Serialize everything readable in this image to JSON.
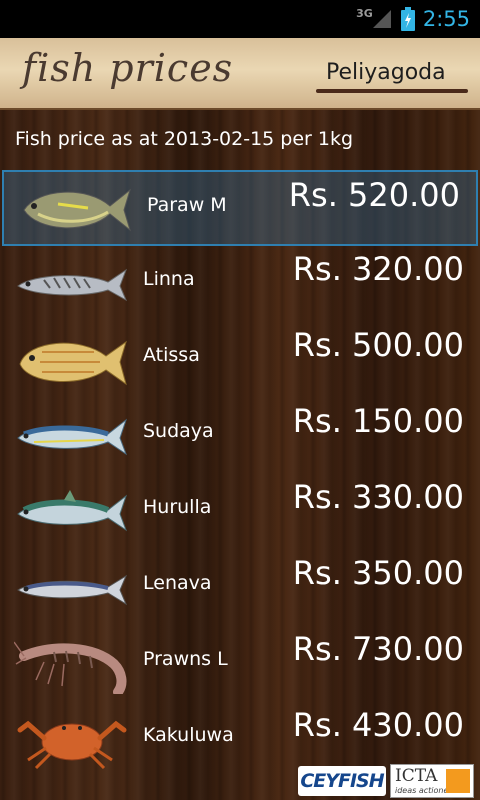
{
  "status_bar": {
    "network": "3G",
    "time": "2:55"
  },
  "header": {
    "title": "fish prices",
    "location": "Peliyagoda"
  },
  "subtitle": "Fish price as at 2013-02-15 per 1kg",
  "fish": [
    {
      "name": "Paraw M",
      "price": "Rs. 520.00",
      "icon": "paraw-fish-icon",
      "selected": true
    },
    {
      "name": "Linna",
      "price": "Rs. 320.00",
      "icon": "linna-fish-icon"
    },
    {
      "name": "Atissa",
      "price": "Rs. 500.00",
      "icon": "atissa-fish-icon"
    },
    {
      "name": "Sudaya",
      "price": "Rs. 150.00",
      "icon": "sudaya-fish-icon"
    },
    {
      "name": "Hurulla",
      "price": "Rs. 330.00",
      "icon": "hurulla-fish-icon"
    },
    {
      "name": "Lenava",
      "price": "Rs. 350.00",
      "icon": "lenava-fish-icon"
    },
    {
      "name": "Prawns L",
      "price": "Rs. 730.00",
      "icon": "prawn-icon"
    },
    {
      "name": "Kakuluwa",
      "price": "Rs. 430.00",
      "icon": "crab-icon"
    }
  ],
  "footer": {
    "logo1": "CEYFISH",
    "logo2": "ICTA",
    "logo2_tagline": "ideas actioned"
  },
  "colors": {
    "accent": "#33b5e5",
    "selection": "#2f7fb0",
    "header_bg": "#e3cda8"
  }
}
